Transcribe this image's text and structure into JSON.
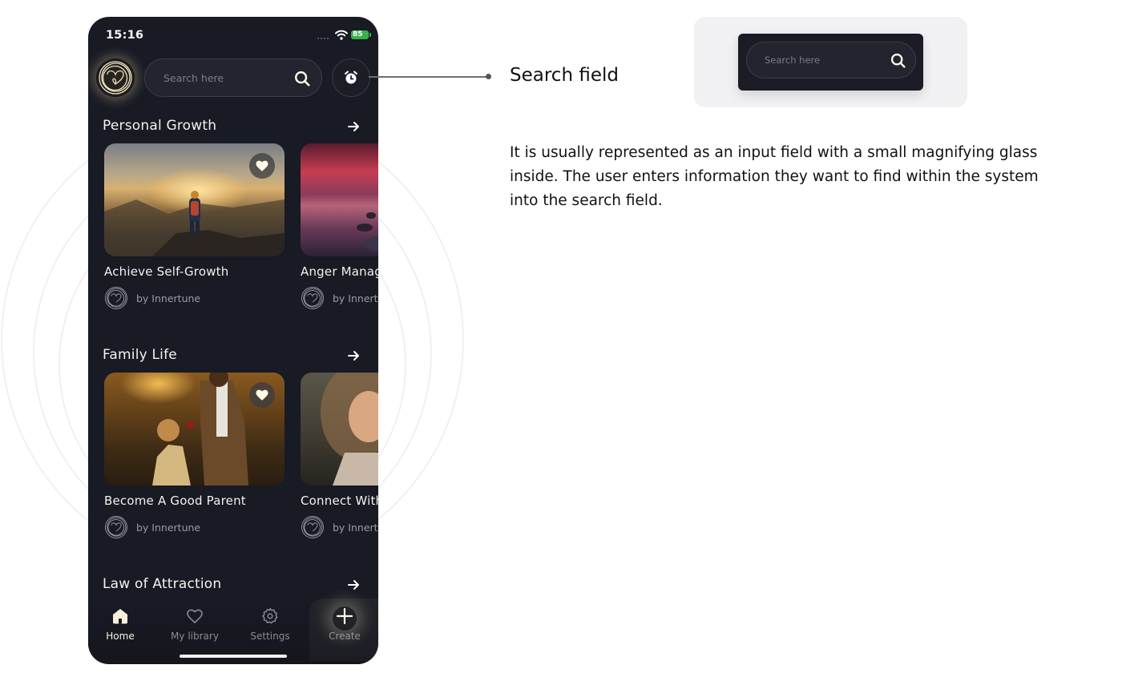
{
  "status_bar": {
    "time": "15:16",
    "battery": "85"
  },
  "header": {
    "search_placeholder": "Search here",
    "icons": {
      "logo": "innertune-logo",
      "search": "search-icon",
      "alarm": "alarm-clock-icon"
    }
  },
  "sections": [
    {
      "title": "Personal Growth",
      "cards": [
        {
          "name": "Achieve Self-Growth",
          "author": "by Innertune",
          "favorited": true
        },
        {
          "name": "Anger Management",
          "author": "by Innertune",
          "favorited": false
        }
      ]
    },
    {
      "title": "Family Life",
      "cards": [
        {
          "name": "Become A Good Parent",
          "author": "by Innertune",
          "favorited": true
        },
        {
          "name": "Connect With",
          "author": "by Innertune",
          "favorited": false
        }
      ]
    },
    {
      "title": "Law of Attraction",
      "cards": []
    }
  ],
  "bottom_nav": [
    {
      "label": "Home",
      "icon": "home-icon",
      "active": true
    },
    {
      "label": "My library",
      "icon": "heart-icon",
      "active": false
    },
    {
      "label": "Settings",
      "icon": "gear-icon",
      "active": false
    },
    {
      "label": "Create",
      "icon": "plus-icon",
      "active": false
    }
  ],
  "annotation": {
    "title": "Search field",
    "description": "It is usually represented as an input field with a small magnifying glass inside. The user enters information they want to find within the system into the search field."
  },
  "preview": {
    "search_placeholder": "Search here"
  },
  "colors": {
    "app_background": "#181a24",
    "accent_cream": "#f4f0dc",
    "battery_green": "#38b24a",
    "preview_background": "#f1f1f3"
  }
}
